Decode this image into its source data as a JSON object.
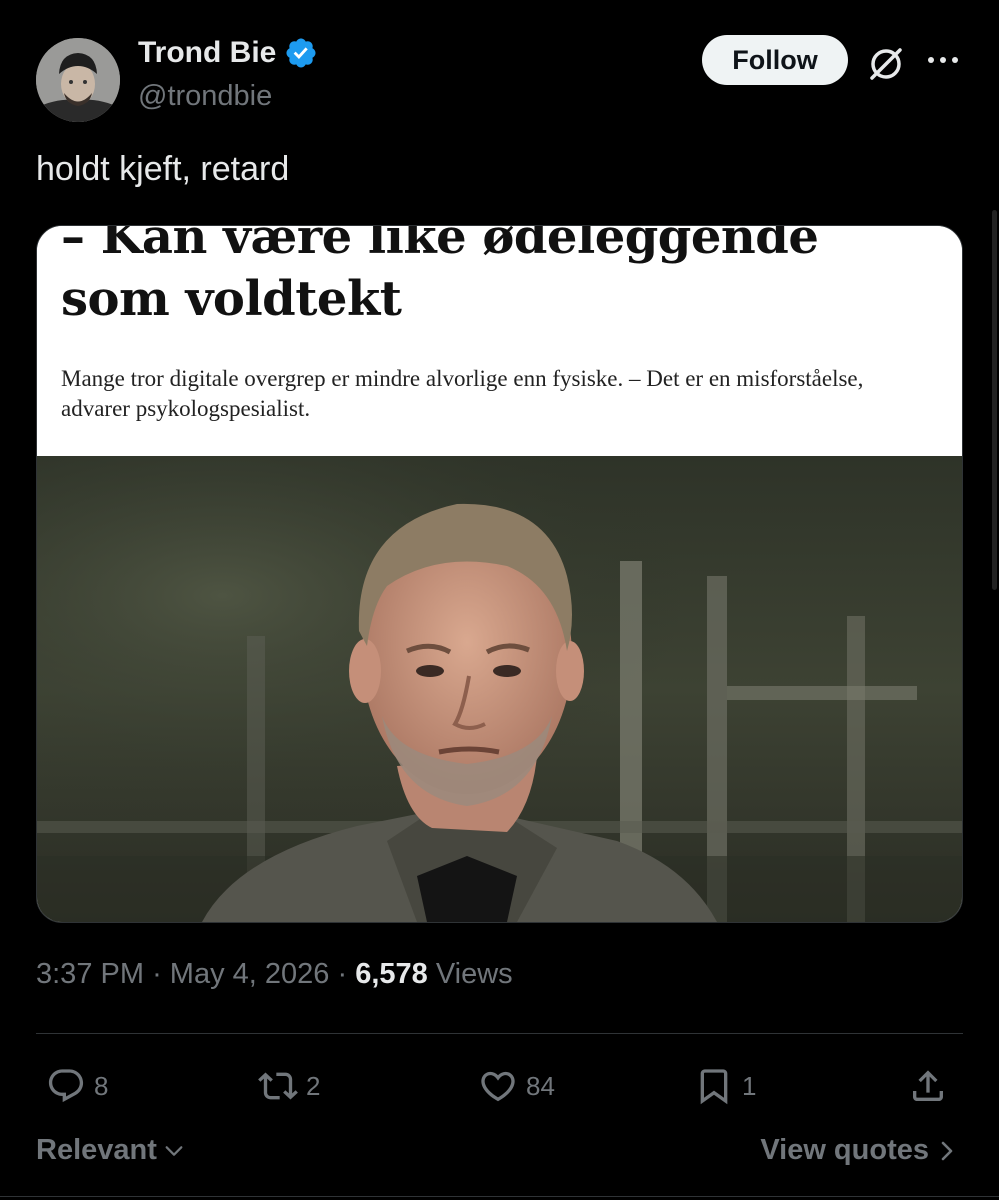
{
  "author": {
    "name": "Trond Bie",
    "handle": "@trondbie",
    "verified": true
  },
  "header": {
    "follow_label": "Follow"
  },
  "tweet": {
    "text": "holdt kjeft, retard"
  },
  "media": {
    "headline": "– Kan være like ødeleggende som voldtekt",
    "lede": "Mange tror digitale overgrep er mindre alvorlige enn fysiske. – Det er en misforståelse, advarer psykologspesialist."
  },
  "meta": {
    "time": "3:37 PM",
    "date": "May 4, 2026",
    "views_count": "6,578",
    "views_label": "Views",
    "separator": "·"
  },
  "actions": {
    "replies": "8",
    "reposts": "2",
    "likes": "84",
    "bookmarks": "1"
  },
  "footer": {
    "sort_label": "Relevant",
    "view_quotes_label": "View quotes"
  },
  "colors": {
    "background": "#000000",
    "text": "#e7e9ea",
    "muted": "#71767b",
    "verified_blue": "#1d9bf0",
    "divider": "#2f3336"
  }
}
